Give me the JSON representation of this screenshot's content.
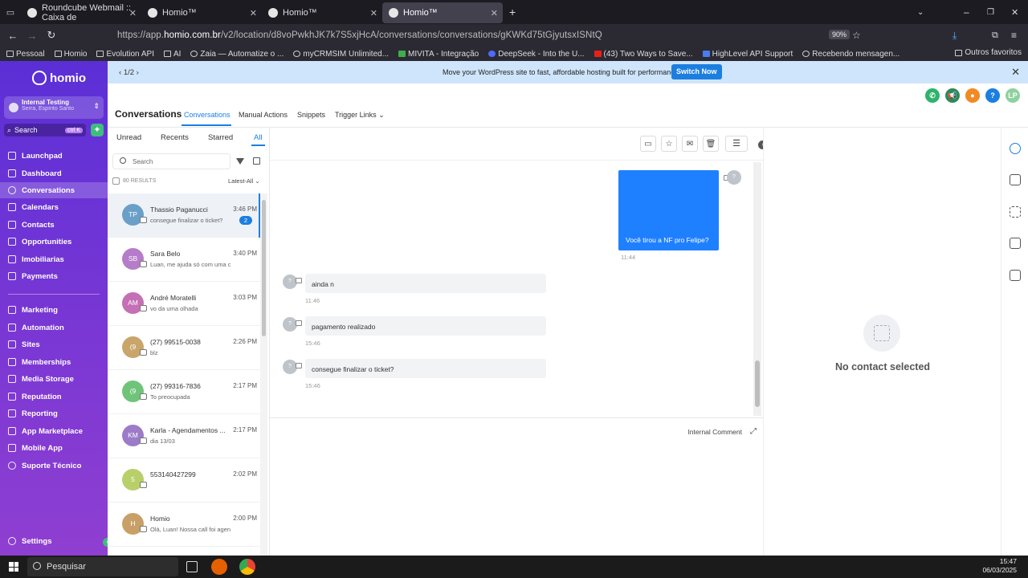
{
  "browser": {
    "tabs": [
      {
        "title": "Roundcube Webmail :: Caixa de",
        "active": false
      },
      {
        "title": "Homio™",
        "active": false
      },
      {
        "title": "Homio™",
        "active": false
      },
      {
        "title": "Homio™",
        "active": true
      }
    ],
    "url_prefix": "https://app.",
    "url_domain": "homio.com.br",
    "url_path": "/v2/location/d8voPwkhJK7k7S5xjHcA/conversations/conversations/gKWKd75tGjyutsxISNtQ",
    "zoom": "90%",
    "bookmarks": [
      "Pessoal",
      "Homio",
      "Evolution API",
      "AI",
      "Zaia — Automatize o ...",
      "myCRMSIM Unlimited...",
      "MIVITA - Integração",
      "DeepSeek - Into the U...",
      "(43) Two Ways to Save...",
      "HighLevel API Support",
      "Recebendo mensagen..."
    ],
    "other_bookmarks": "Outros favoritos"
  },
  "sidebar": {
    "brand": "homio",
    "account_name": "Internal Testing",
    "account_location": "Serra, Espírito Santo",
    "search_label": "Search",
    "search_shortcut": "ctrl K",
    "nav_top": [
      "Launchpad",
      "Dashboard",
      "Conversations",
      "Calendars",
      "Contacts",
      "Opportunities",
      "Imobiliarias",
      "Payments"
    ],
    "nav_bottom": [
      "Marketing",
      "Automation",
      "Sites",
      "Memberships",
      "Media Storage",
      "Reputation",
      "Reporting",
      "App Marketplace",
      "Mobile App",
      "Suporte Técnico"
    ],
    "active_item": "Conversations",
    "settings_label": "Settings"
  },
  "banner": {
    "pager": "1/2",
    "message": "Move your WordPress site to fast, affordable hosting built for performance!",
    "cta": "Switch Now"
  },
  "header": {
    "title": "Conversations",
    "tabs": [
      "Conversations",
      "Manual Actions",
      "Snippets",
      "Trigger Links"
    ],
    "active_tab": "Conversations",
    "user_initials": "LP",
    "help_label": "?"
  },
  "list": {
    "filters": [
      "Unread",
      "Recents",
      "Starred",
      "All"
    ],
    "active_filter": "All",
    "search_placeholder": "Search",
    "results": "80 RESULTS",
    "sort": "Latest-All",
    "items": [
      {
        "initials": "TP",
        "name": "Thassio Paganucci",
        "preview": "consegue finalizar o ticket?",
        "time": "3:46 PM",
        "badge": "2",
        "color": "#6aa0c8"
      },
      {
        "initials": "SB",
        "name": "Sara Belo",
        "preview": "Luan, me ajuda só com uma coi",
        "time": "3:40 PM",
        "badge": "",
        "color": "#b57cc9"
      },
      {
        "initials": "AM",
        "name": "André Moratelli",
        "preview": "vo da uma olhada",
        "time": "3:03 PM",
        "badge": "",
        "color": "#c56fb5"
      },
      {
        "initials": "(9",
        "name": "(27) 99515-0038",
        "preview": "blz",
        "time": "2:26 PM",
        "badge": "",
        "color": "#c9a56a"
      },
      {
        "initials": "(9",
        "name": "(27) 99316-7836",
        "preview": "To preocupada",
        "time": "2:17 PM",
        "badge": "",
        "color": "#6fc47a"
      },
      {
        "initials": "KM",
        "name": "Karla - Agendamentos ...",
        "preview": "dia 13/03",
        "time": "2:17 PM",
        "badge": "",
        "color": "#9c7bc9"
      },
      {
        "initials": "5",
        "name": "553140427299",
        "preview": "",
        "time": "2:02 PM",
        "badge": "",
        "color": "#b9cf6a"
      },
      {
        "initials": "H",
        "name": "Homio",
        "preview": "Olá, Luan! Nossa call foi agend",
        "time": "2:00 PM",
        "badge": "",
        "color": "#c8a067"
      }
    ]
  },
  "chat": {
    "outgoing": {
      "text": "Você tirou a NF pro Felipe?",
      "time": "11:44"
    },
    "incoming": [
      {
        "text": "ainda n",
        "time": "11:46"
      },
      {
        "text": "pagamento realizado",
        "time": "15:46"
      },
      {
        "text": "consegue finalizar o ticket?",
        "time": "15:46"
      }
    ],
    "avatar_placeholder": "?",
    "composer_mode": "Internal Comment"
  },
  "contact_panel": {
    "empty_text": "No contact selected"
  },
  "taskbar": {
    "search_placeholder": "Pesquisar",
    "time": "15:47",
    "date": "06/03/2025"
  },
  "colors": {
    "accent": "#1c7fe0",
    "sidebar_top": "#5b2fd6",
    "sidebar_bottom": "#8f3fd1",
    "banner_bg": "#cfe5fb",
    "outgoing_bubble": "#1f80ff"
  }
}
